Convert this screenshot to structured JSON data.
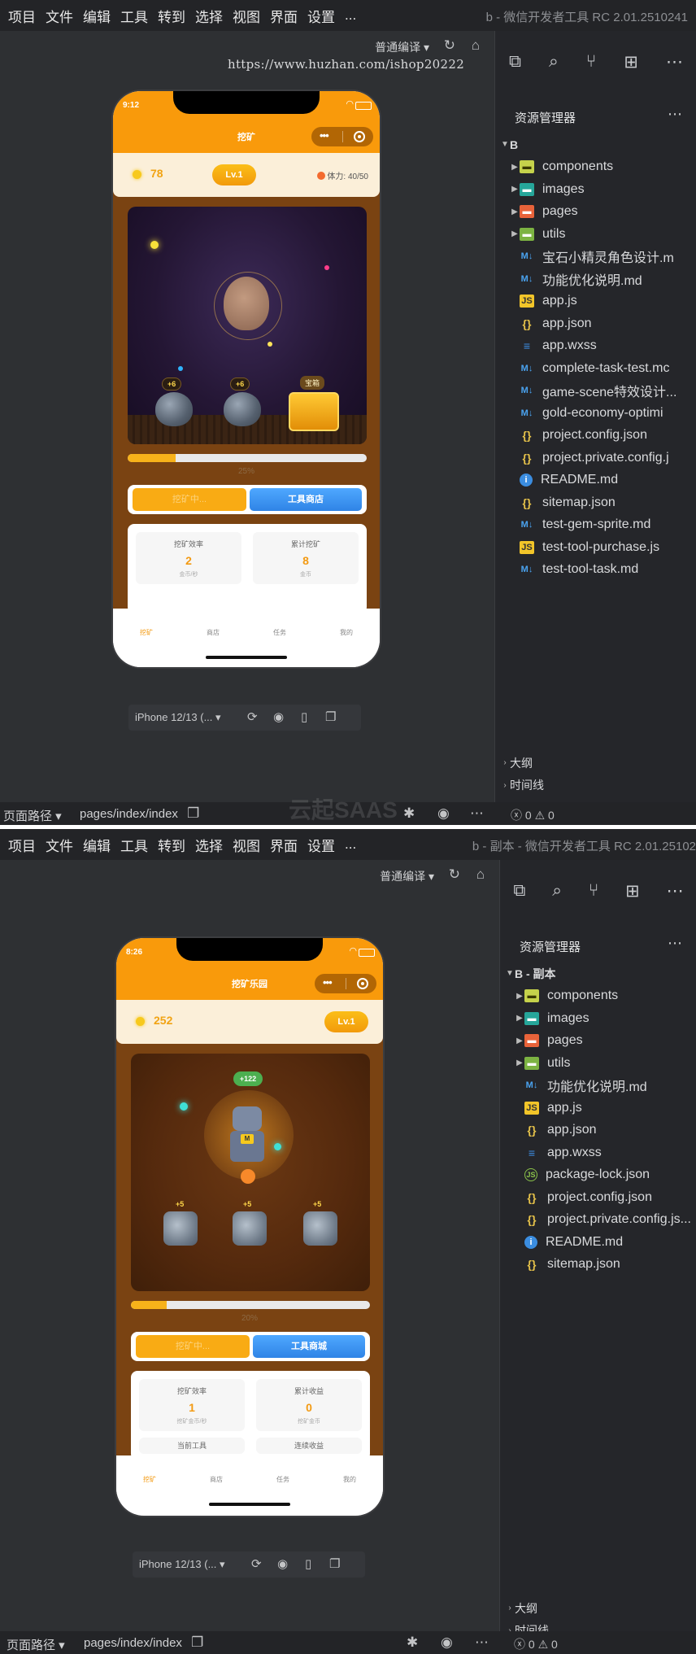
{
  "window1": {
    "menu": [
      "项目",
      "文件",
      "编辑",
      "工具",
      "转到",
      "选择",
      "视图",
      "界面",
      "设置",
      "..."
    ],
    "title": "b - 微信开发者工具 RC 2.01.2510241",
    "compile_mode": "普通编译",
    "watermark_url": "https://www.huzhan.com/ishop20222",
    "explorer_title": "资源管理器",
    "root": "B",
    "folders": [
      "components",
      "images",
      "pages",
      "utils"
    ],
    "files": [
      {
        "name": "宝石小精灵角色设计.m",
        "type": "md"
      },
      {
        "name": "功能优化说明.md",
        "type": "md"
      },
      {
        "name": "app.js",
        "type": "js"
      },
      {
        "name": "app.json",
        "type": "json"
      },
      {
        "name": "app.wxss",
        "type": "css"
      },
      {
        "name": "complete-task-test.mc",
        "type": "md"
      },
      {
        "name": "game-scene特效设计...",
        "type": "md"
      },
      {
        "name": "gold-economy-optimi",
        "type": "md"
      },
      {
        "name": "project.config.json",
        "type": "json"
      },
      {
        "name": "project.private.config.j",
        "type": "json"
      },
      {
        "name": "README.md",
        "type": "info"
      },
      {
        "name": "sitemap.json",
        "type": "json"
      },
      {
        "name": "test-gem-sprite.md",
        "type": "md"
      },
      {
        "name": "test-tool-purchase.js",
        "type": "js"
      },
      {
        "name": "test-tool-task.md",
        "type": "md"
      }
    ],
    "outline": "大纲",
    "timeline": "时间线",
    "status_path_label": "页面路径",
    "status_path": "pages/index/index",
    "errors": "0",
    "warnings": "0",
    "watermark_text": "云起SAAS",
    "device": "iPhone 12/13 (...",
    "phone": {
      "time": "9:12",
      "nav_title": "挖矿",
      "coins": "78",
      "level": "Lv.1",
      "stamina": "体力: 40/50",
      "rock_tags": [
        "+6",
        "+6"
      ],
      "chest_tag": "宝箱",
      "progress_pct": 20,
      "progress_label": "25%",
      "btn_mine": "挖矿中...",
      "btn_shop": "工具商店",
      "stat1_label": "挖矿效率",
      "stat1_value": "2",
      "stat1_unit": "金币/秒",
      "stat2_label": "累计挖矿",
      "stat2_value": "8",
      "stat2_unit": "金币",
      "tabs": [
        "挖矿",
        "商店",
        "任务",
        "我的"
      ]
    }
  },
  "window2": {
    "menu": [
      "项目",
      "文件",
      "编辑",
      "工具",
      "转到",
      "选择",
      "视图",
      "界面",
      "设置",
      "..."
    ],
    "title": "b - 副本 - 微信开发者工具 RC 2.01.25102",
    "compile_mode": "普通编译",
    "explorer_title": "资源管理器",
    "root": "B - 副本",
    "folders": [
      "components",
      "images",
      "pages",
      "utils"
    ],
    "files": [
      {
        "name": "功能优化说明.md",
        "type": "md"
      },
      {
        "name": "app.js",
        "type": "js"
      },
      {
        "name": "app.json",
        "type": "json"
      },
      {
        "name": "app.wxss",
        "type": "css"
      },
      {
        "name": "package-lock.json",
        "type": "pkg"
      },
      {
        "name": "project.config.json",
        "type": "json"
      },
      {
        "name": "project.private.config.js...",
        "type": "json"
      },
      {
        "name": "README.md",
        "type": "info"
      },
      {
        "name": "sitemap.json",
        "type": "json"
      }
    ],
    "outline": "大纲",
    "timeline": "时间线",
    "status_path_label": "页面路径",
    "status_path": "pages/index/index",
    "errors": "0",
    "warnings": "0",
    "device": "iPhone 12/13 (...",
    "phone": {
      "time": "8:26",
      "nav_title": "挖矿乐园",
      "coins": "252",
      "level": "Lv.1",
      "bubble": "+122",
      "rock_tags": [
        "+5",
        "+5",
        "+5"
      ],
      "robot_badge": "M",
      "progress_pct": 15,
      "progress_label": "20%",
      "btn_mine": "挖矿中...",
      "btn_shop": "工具商城",
      "stat1_label": "挖矿效率",
      "stat1_value": "1",
      "stat1_unit": "挖矿金币/秒",
      "stat2_label": "累计收益",
      "stat2_value": "0",
      "stat2_unit": "挖矿金币",
      "stat3_label": "当前工具",
      "stat4_label": "连续收益",
      "tabs": [
        "挖矿",
        "商店",
        "任务",
        "我的"
      ]
    }
  },
  "colors": {
    "accent_orange": "#f99a0b",
    "shop_blue": "#2f84e6",
    "ide_bg": "#2e3033"
  }
}
